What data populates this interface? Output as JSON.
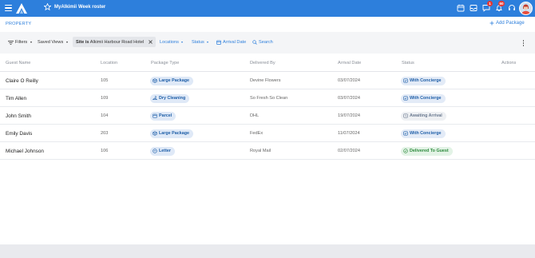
{
  "topbar": {
    "links": [
      "MyAlkimii",
      "Week roster"
    ],
    "badges": {
      "chat": "1",
      "bell": "60"
    },
    "brand_color": "#2d7fdc"
  },
  "page": {
    "section_label": "PROPERTY",
    "add_button": "Add Package"
  },
  "filters": {
    "filters_label": "Filters",
    "saved_views_label": "Saved Views",
    "chip_field": "Site",
    "chip_op": "is",
    "chip_value": "Alkimii Harbour Road Hotel",
    "locations_label": "Locations",
    "status_label": "Status",
    "arrival_date_label": "Arrival Date",
    "search_label": "Search"
  },
  "table": {
    "columns": [
      "Guest Name",
      "Location",
      "Package Type",
      "Delivered By",
      "Arrival Date",
      "Status",
      "Actions"
    ],
    "rows": [
      {
        "guest": "Claire O Reilly",
        "location": "105",
        "package_type": "Large Package",
        "package_icon": "box-icon",
        "delivered_by": "Devine Flowers",
        "arrival_date": "03/07/2024",
        "status": "With Concierge",
        "status_kind": "concierge"
      },
      {
        "guest": "Tim Allen",
        "location": "109",
        "package_type": "Dry Cleaning",
        "package_icon": "hanger-icon",
        "delivered_by": "So Fresh So Clean",
        "arrival_date": "03/07/2024",
        "status": "With Concierge",
        "status_kind": "concierge"
      },
      {
        "guest": "John Smith",
        "location": "104",
        "package_type": "Parcel",
        "package_icon": "parcel-icon",
        "delivered_by": "DHL",
        "arrival_date": "19/07/2024",
        "status": "Awaiting Arrival",
        "status_kind": "awaiting"
      },
      {
        "guest": "Emily Davis",
        "location": "203",
        "package_type": "Large Package",
        "package_icon": "box-icon",
        "delivered_by": "FedEx",
        "arrival_date": "11/07/2024",
        "status": "With Concierge",
        "status_kind": "concierge"
      },
      {
        "guest": "Michael Johnson",
        "location": "106",
        "package_type": "Letter",
        "package_icon": "letter-icon",
        "delivered_by": "Royal Mail",
        "arrival_date": "02/07/2024",
        "status": "Delivered To Guest",
        "status_kind": "delivered"
      }
    ]
  }
}
